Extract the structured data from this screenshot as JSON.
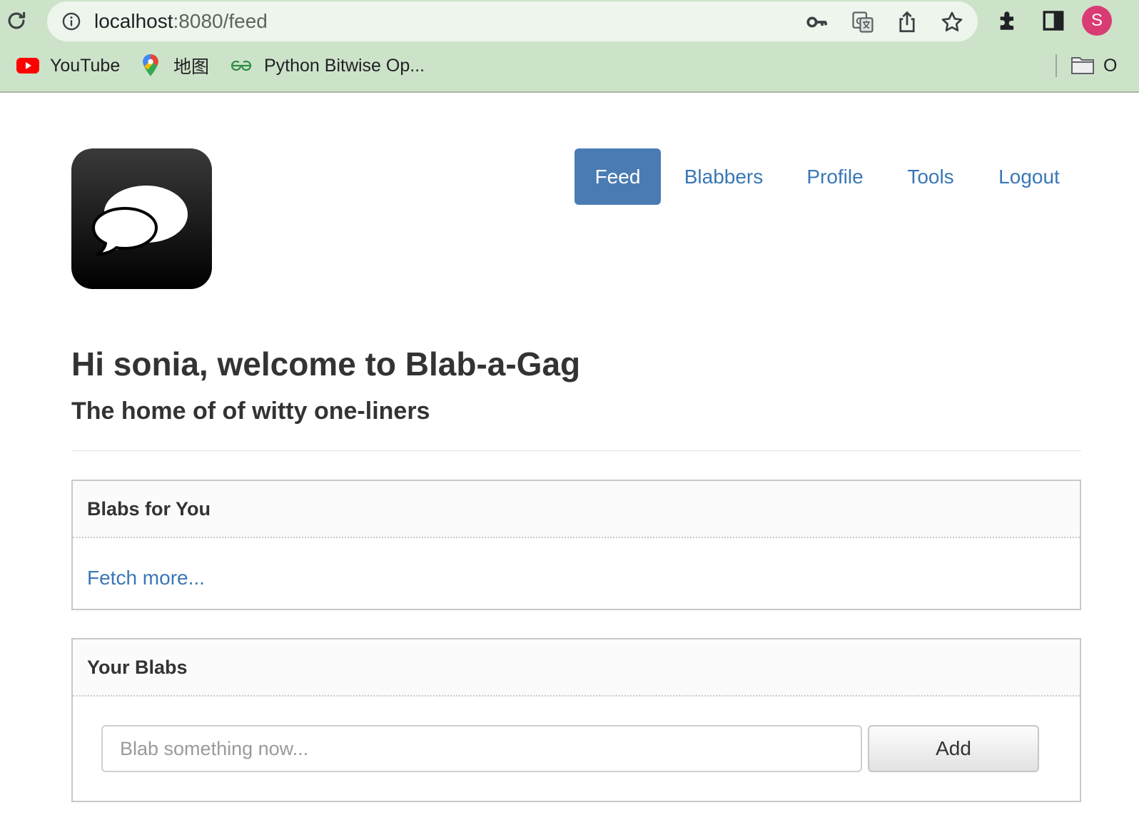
{
  "browser": {
    "url_host": "localhost",
    "url_path": ":8080/feed",
    "profile_initial": "S",
    "bookmarks": [
      {
        "label": "YouTube",
        "icon": "youtube-icon"
      },
      {
        "label": "地图",
        "icon": "maps-pin-icon"
      },
      {
        "label": "Python Bitwise Op...",
        "icon": "geeksforgeeks-icon"
      }
    ],
    "other_bookmarks_label": "O"
  },
  "nav": {
    "items": [
      {
        "label": "Feed",
        "active": true
      },
      {
        "label": "Blabbers",
        "active": false
      },
      {
        "label": "Profile",
        "active": false
      },
      {
        "label": "Tools",
        "active": false
      },
      {
        "label": "Logout",
        "active": false
      }
    ]
  },
  "header": {
    "title": "Hi sonia, welcome to Blab-a-Gag",
    "subtitle": "The home of of witty one-liners"
  },
  "blabs_for_you": {
    "heading": "Blabs for You",
    "fetch_more": "Fetch more..."
  },
  "your_blabs": {
    "heading": "Your Blabs",
    "input_placeholder": "Blab something now...",
    "add_label": "Add"
  },
  "colors": {
    "chrome_bg": "#cde3c9",
    "link": "#3a77b6",
    "active_nav_bg": "#4a7cb3",
    "avatar": "#d93c75"
  }
}
